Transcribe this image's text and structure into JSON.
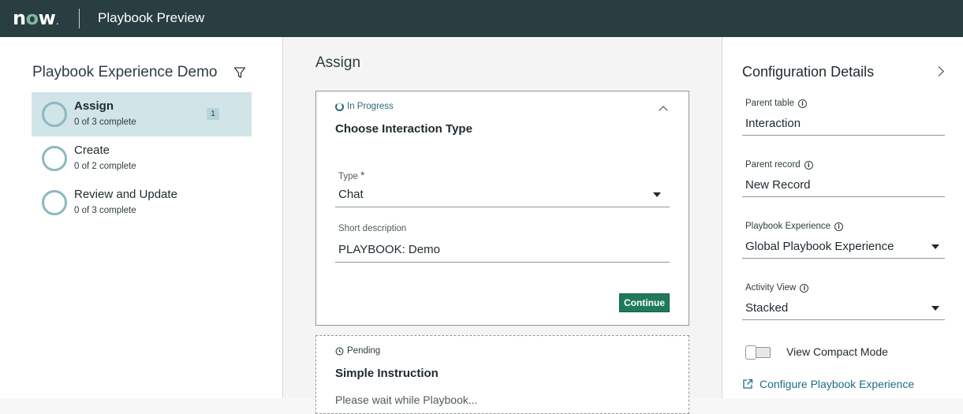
{
  "app": {
    "logo": "now",
    "title": "Playbook Preview"
  },
  "left_panel": {
    "title": "Playbook Experience Demo",
    "phases": [
      {
        "name": "Assign",
        "progress": "0 of 3 complete",
        "badge": "1",
        "active": true
      },
      {
        "name": "Create",
        "progress": "0 of 2 complete"
      },
      {
        "name": "Review and Update",
        "progress": "0 of 3 complete"
      }
    ]
  },
  "center_panel": {
    "title": "Assign",
    "active_card": {
      "status": "In Progress",
      "title": "Choose Interaction Type",
      "fields": [
        {
          "label": "Type",
          "value": "Chat",
          "required_marker": "*"
        },
        {
          "label": "Short description",
          "value": "PLAYBOOK: Demo"
        }
      ],
      "continue_label": "Continue"
    },
    "pending_card": {
      "status": "Pending",
      "title": "Simple Instruction",
      "body_partial": "Please wait while Playbook..."
    }
  },
  "right_panel": {
    "title": "Configuration Details",
    "fields": [
      {
        "label": "Parent table",
        "value": "Interaction"
      },
      {
        "label": "Parent record",
        "value": "New Record"
      },
      {
        "label": "Playbook Experience",
        "value": "Global Playbook Experience"
      },
      {
        "label": "Activity View",
        "value": "Stacked"
      }
    ],
    "toggle_label": "View Compact Mode",
    "link_label": "Configure Playbook Experience"
  },
  "colors": {
    "header_bg": "#293e40",
    "active_phase_bg": "#d1e4e8",
    "primary_button": "#1f7a5c",
    "link": "#1d6d87"
  }
}
